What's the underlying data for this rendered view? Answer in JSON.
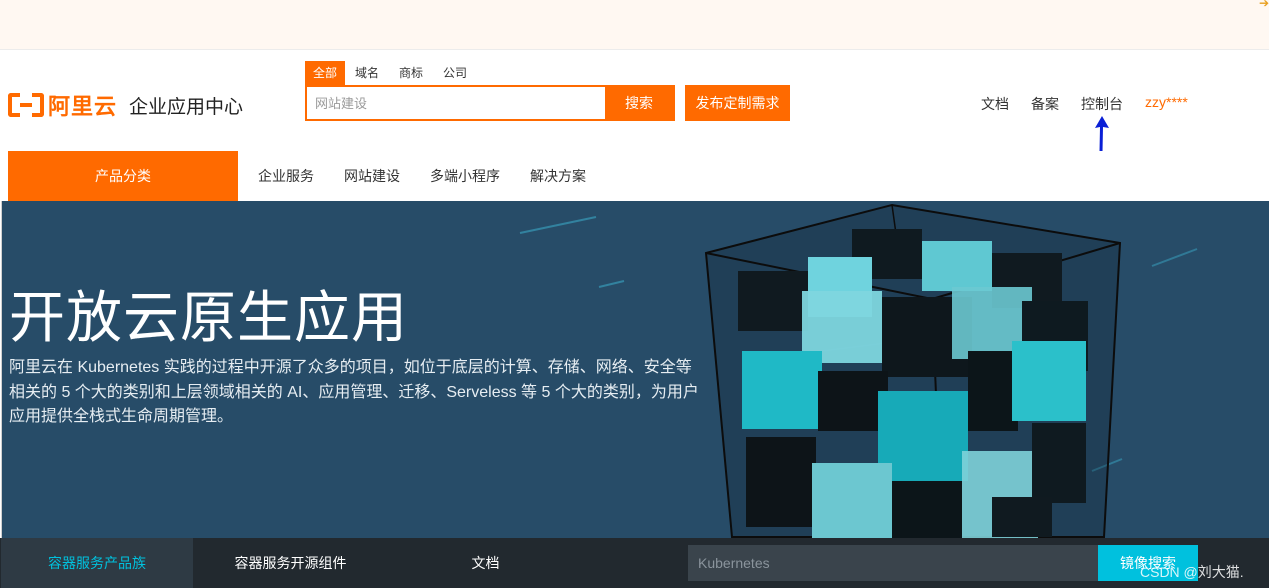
{
  "topbar": {
    "corner_icon": "arrow-fragment-icon"
  },
  "logo": {
    "brand": "阿里云",
    "subtitle": "企业应用中心"
  },
  "search": {
    "tabs": [
      "全部",
      "域名",
      "商标",
      "公司"
    ],
    "active_tab": "全部",
    "placeholder": "网站建设",
    "button": "搜索"
  },
  "publish_button": "发布定制需求",
  "right_links": {
    "docs": "文档",
    "filing": "备案",
    "console": "控制台",
    "user": "zzy****"
  },
  "annotation": {
    "arrow_color": "#0a1fd6"
  },
  "nav": {
    "category": "产品分类",
    "items": [
      "企业服务",
      "网站建设",
      "多端小程序",
      "解决方案"
    ]
  },
  "hero": {
    "title": "开放云原生应用",
    "description": "阿里云在 Kubernetes 实践的过程中开源了众多的项目，如位于底层的计算、存储、网络、安全等相关的 5 个大的类别和上层领域相关的 AI、应用管理、迁移、Serveless 等 5 个大的类别，为用户应用提供全栈式生命周期管理。",
    "background": "#274c68"
  },
  "bottom": {
    "tabs": [
      "容器服务产品族",
      "容器服务开源组件",
      "文档"
    ],
    "search_placeholder": "Kubernetes",
    "search_button": "镜像搜索"
  },
  "watermark": "CSDN @刘大猫.",
  "colors": {
    "brand": "#ff6a00",
    "accent": "#00c1de",
    "dark": "#22292f"
  }
}
